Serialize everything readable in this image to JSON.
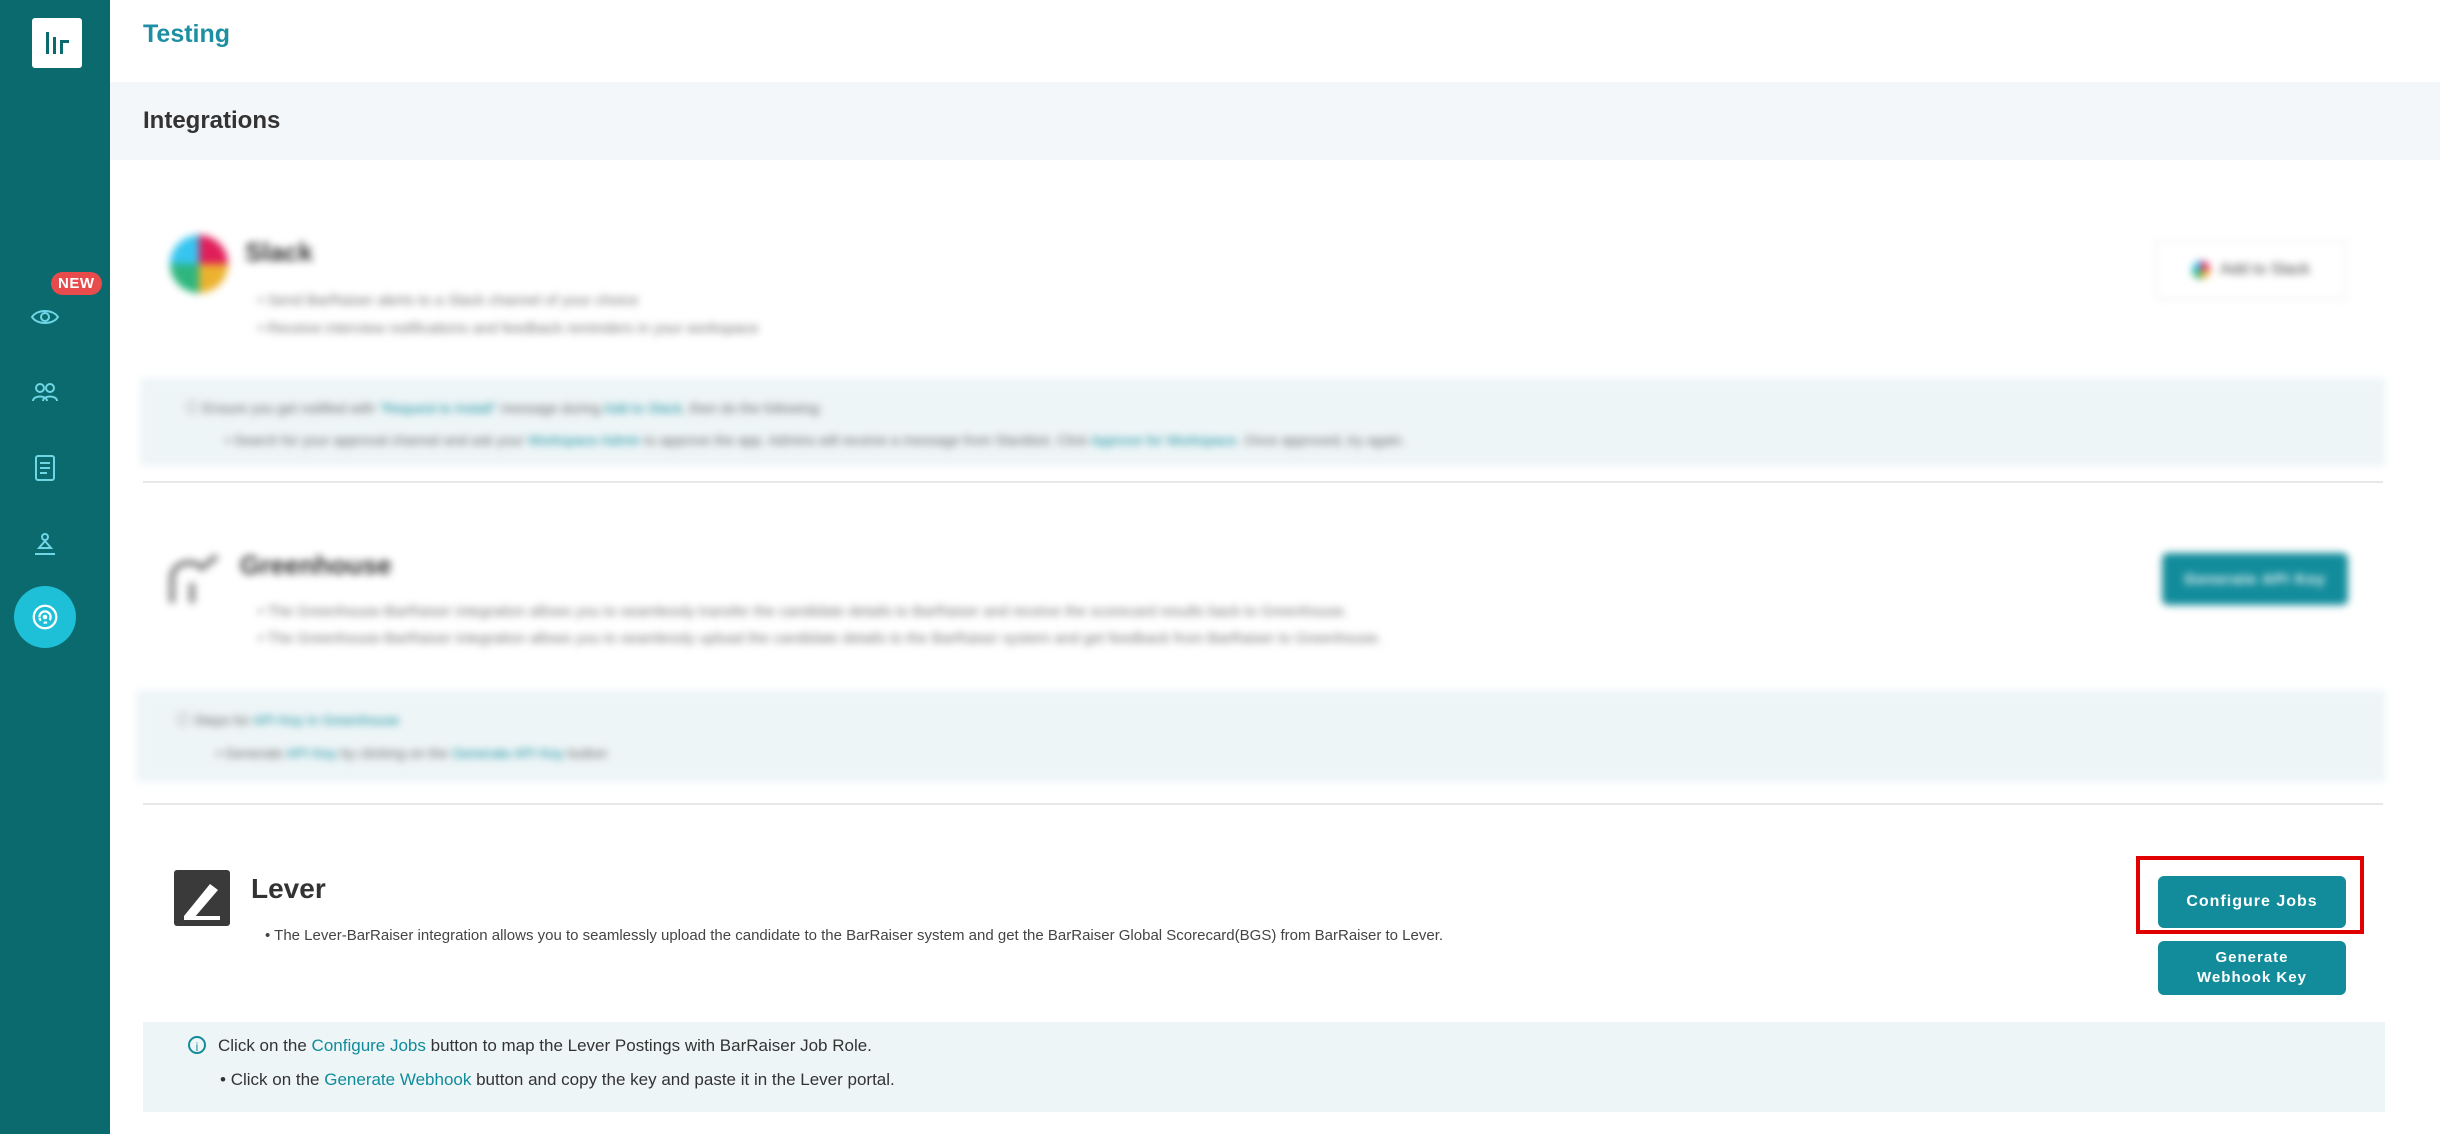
{
  "header": {
    "breadcrumb": "Testing",
    "page_title": "Integrations"
  },
  "sidebar": {
    "badge": "NEW",
    "icons": [
      "eye-icon",
      "users-icon",
      "document-icon",
      "rank-icon",
      "integrations-icon"
    ]
  },
  "slack": {
    "title": "Slack",
    "bullets": [
      "Send BarRaiser alerts to a Slack channel of your choice",
      "Receive interview notifications and feedback reminders in your workspace"
    ],
    "button_label": "Add to Slack",
    "info": {
      "line1_pre": "Ensure you get notified with ",
      "line1_link1": "\"Request to Install\"",
      "line1_mid": " message during ",
      "line1_link2": "Add to Slack",
      "line1_post": ", then do the following:",
      "line2_pre": "Search for your approval channel and ask your ",
      "line2_link1": "Workspace Admin",
      "line2_mid": " to approve the app. Admins will receive a message from Slackbot. Click ",
      "line2_link2": "Approve for Workspace",
      "line2_post": ". Once approved, try again."
    }
  },
  "greenhouse": {
    "title": "Greenhouse",
    "bullets": [
      "The Greenhouse-BarRaiser integration allows you to seamlessly transfer the candidate details to BarRaiser and receive the scorecard results back to Greenhouse.",
      "The Greenhouse-BarRaiser integration allows you to seamlessly upload the candidate details to the BarRaiser system and get feedback from BarRaiser to Greenhouse."
    ],
    "button_label": "Generate API Key",
    "info": {
      "line1_pre": "Steps for ",
      "line1_link": "API Key in Greenhouse",
      "line2_pre": "Generate ",
      "line2_link1": "API Key",
      "line2_mid": " by clicking on the ",
      "line2_link2": "Generate API Key",
      "line2_post": " button"
    }
  },
  "lever": {
    "title": "Lever",
    "bullet": "The Lever-BarRaiser integration allows you to seamlessly upload the candidate to the BarRaiser system and get the BarRaiser Global Scorecard(BGS) from BarRaiser to Lever.",
    "configure_button": "Configure Jobs",
    "webhook_button_line1": "Generate",
    "webhook_button_line2": "Webhook Key",
    "info": {
      "line1_pre": "Click on the ",
      "line1_link": "Configure Jobs",
      "line1_post": " button to map the Lever Postings with BarRaiser Job Role.",
      "line2_pre": "Click on the ",
      "line2_link": "Generate Webhook",
      "line2_post": " button and copy the key and paste it in the Lever portal."
    }
  },
  "colors": {
    "sidebar": "#0b6a6e",
    "accent": "#128c9b",
    "active": "#1ec0d8",
    "badge": "#e74b4b",
    "highlight": "#e00000"
  }
}
